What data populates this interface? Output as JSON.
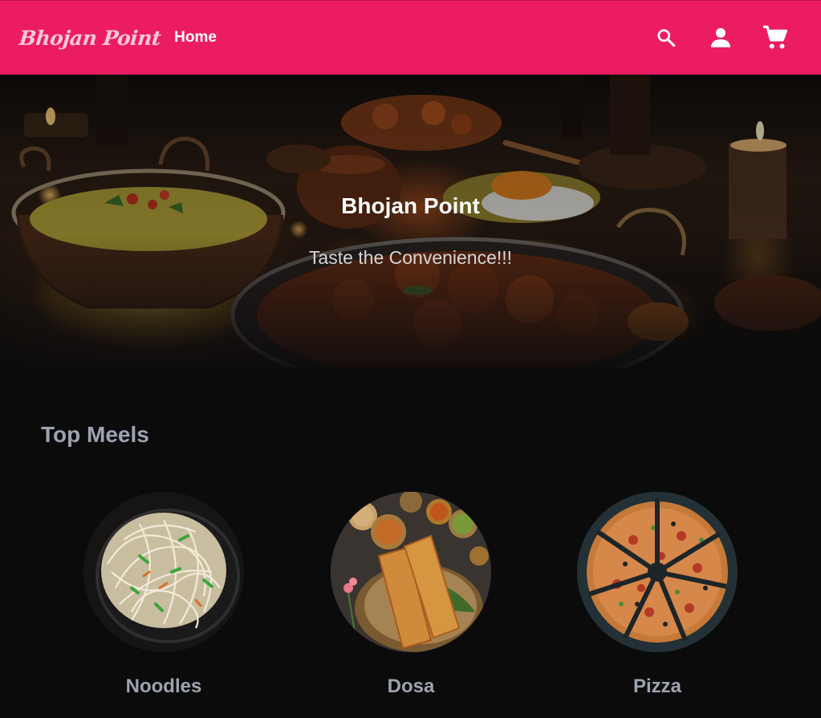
{
  "navbar": {
    "brand": "Bhojan Point",
    "home_label": "Home",
    "icons": [
      "search-icon",
      "account-icon",
      "cart-icon"
    ],
    "background_color": "#ec1c63"
  },
  "hero": {
    "title": "Bhojan Point",
    "subtitle": "Taste the Convenience!!!"
  },
  "top_meals": {
    "title": "Top Meels",
    "items": [
      {
        "label": "Noodles",
        "icon": "noodles-image"
      },
      {
        "label": "Dosa",
        "icon": "dosa-image"
      },
      {
        "label": "Pizza",
        "icon": "pizza-image"
      }
    ]
  }
}
